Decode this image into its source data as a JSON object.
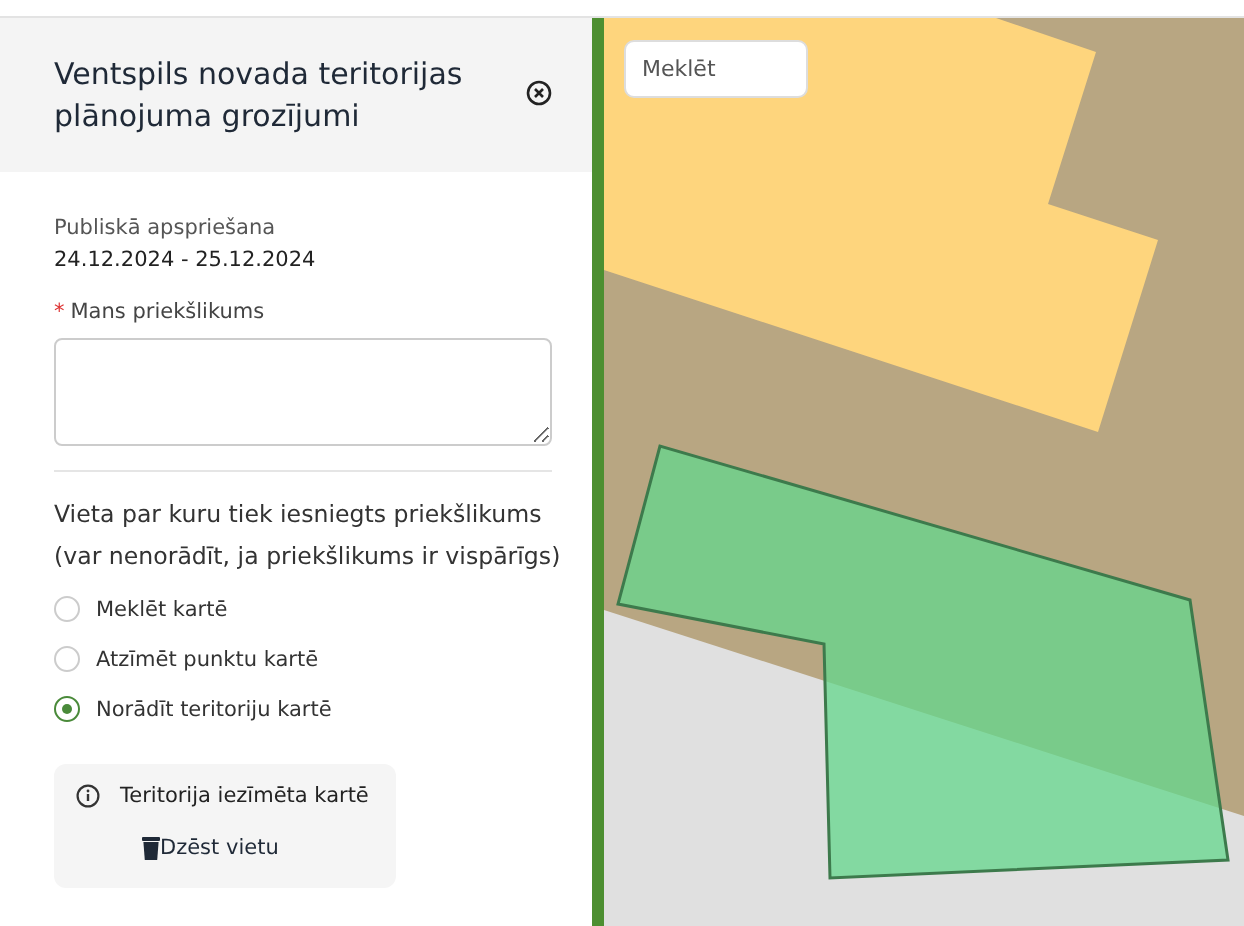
{
  "panel": {
    "title": "Ventspils novada teritorijas plānojuma grozījumi",
    "consultation": {
      "label": "Publiskā apspriešana",
      "dates": "24.12.2024 - 25.12.2024"
    },
    "proposal_field": {
      "required_mark": "*",
      "label": "Mans priekšlikums"
    },
    "location": {
      "heading": "Vieta par kuru tiek iesniegts priekšlikums (var nenorādīt, ja priekšlikums ir vispārīgs)",
      "options": [
        {
          "label": "Meklēt kartē",
          "selected": false
        },
        {
          "label": "Atzīmēt punktu kartē",
          "selected": false
        },
        {
          "label": "Norādīt teritoriju kartē",
          "selected": true
        }
      ],
      "info": {
        "text": "Teritorija iezīmēta kartē",
        "delete_button": "Dzēst vietu"
      }
    }
  },
  "map": {
    "search": {
      "placeholder": "Meklēt"
    }
  }
}
